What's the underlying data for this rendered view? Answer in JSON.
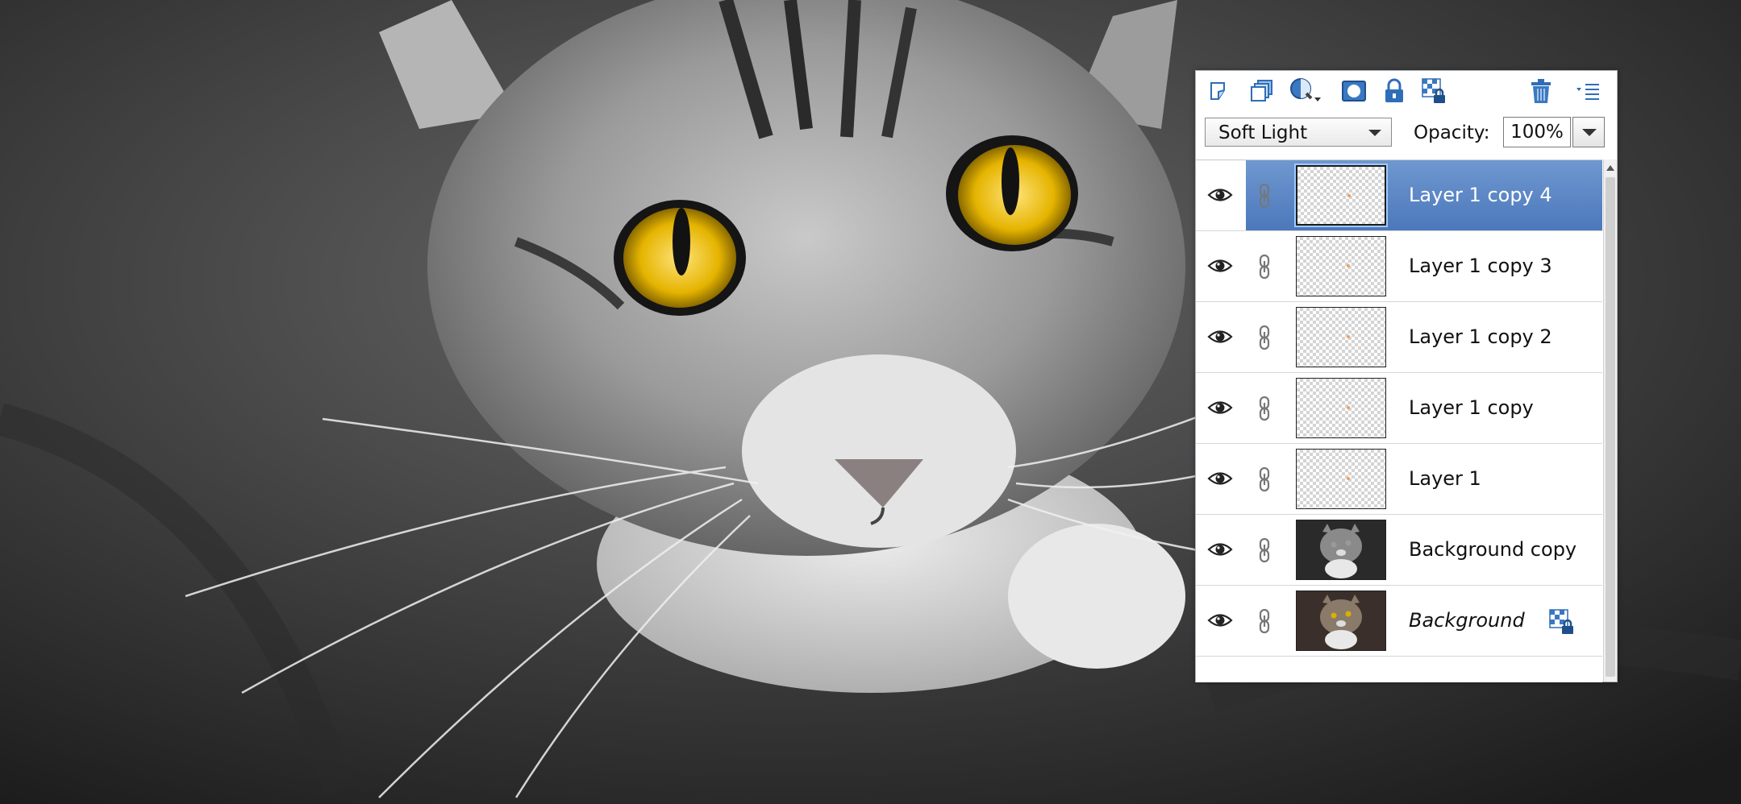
{
  "canvas": {
    "description_icon": "photo-canvas"
  },
  "toolbar": {
    "buttons": [
      {
        "icon": "new-layer-icon"
      },
      {
        "icon": "new-group-icon"
      },
      {
        "icon": "adjustment-layer-icon"
      },
      {
        "icon": "layer-mask-icon"
      },
      {
        "icon": "lock-all-icon"
      },
      {
        "icon": "lock-transparent-icon"
      },
      {
        "icon": "trash-icon"
      },
      {
        "icon": "panel-menu-icon"
      }
    ]
  },
  "blend": {
    "mode": "Soft Light",
    "opacity_label": "Opacity:",
    "opacity_value": "100%"
  },
  "layers": [
    {
      "name": "Layer 1 copy 4",
      "selected": true,
      "thumb": "transparent"
    },
    {
      "name": "Layer 1 copy 3",
      "selected": false,
      "thumb": "transparent"
    },
    {
      "name": "Layer 1 copy 2",
      "selected": false,
      "thumb": "transparent"
    },
    {
      "name": "Layer 1 copy",
      "selected": false,
      "thumb": "transparent"
    },
    {
      "name": "Layer 1",
      "selected": false,
      "thumb": "transparent"
    },
    {
      "name": "Background copy",
      "selected": false,
      "thumb": "photo-bw"
    },
    {
      "name": "Background",
      "selected": false,
      "thumb": "photo-color",
      "locked": true
    }
  ],
  "colors": {
    "selection": "#4c78bb",
    "icon_blue": "#3a78c2",
    "eye_color": "#f2c200"
  }
}
